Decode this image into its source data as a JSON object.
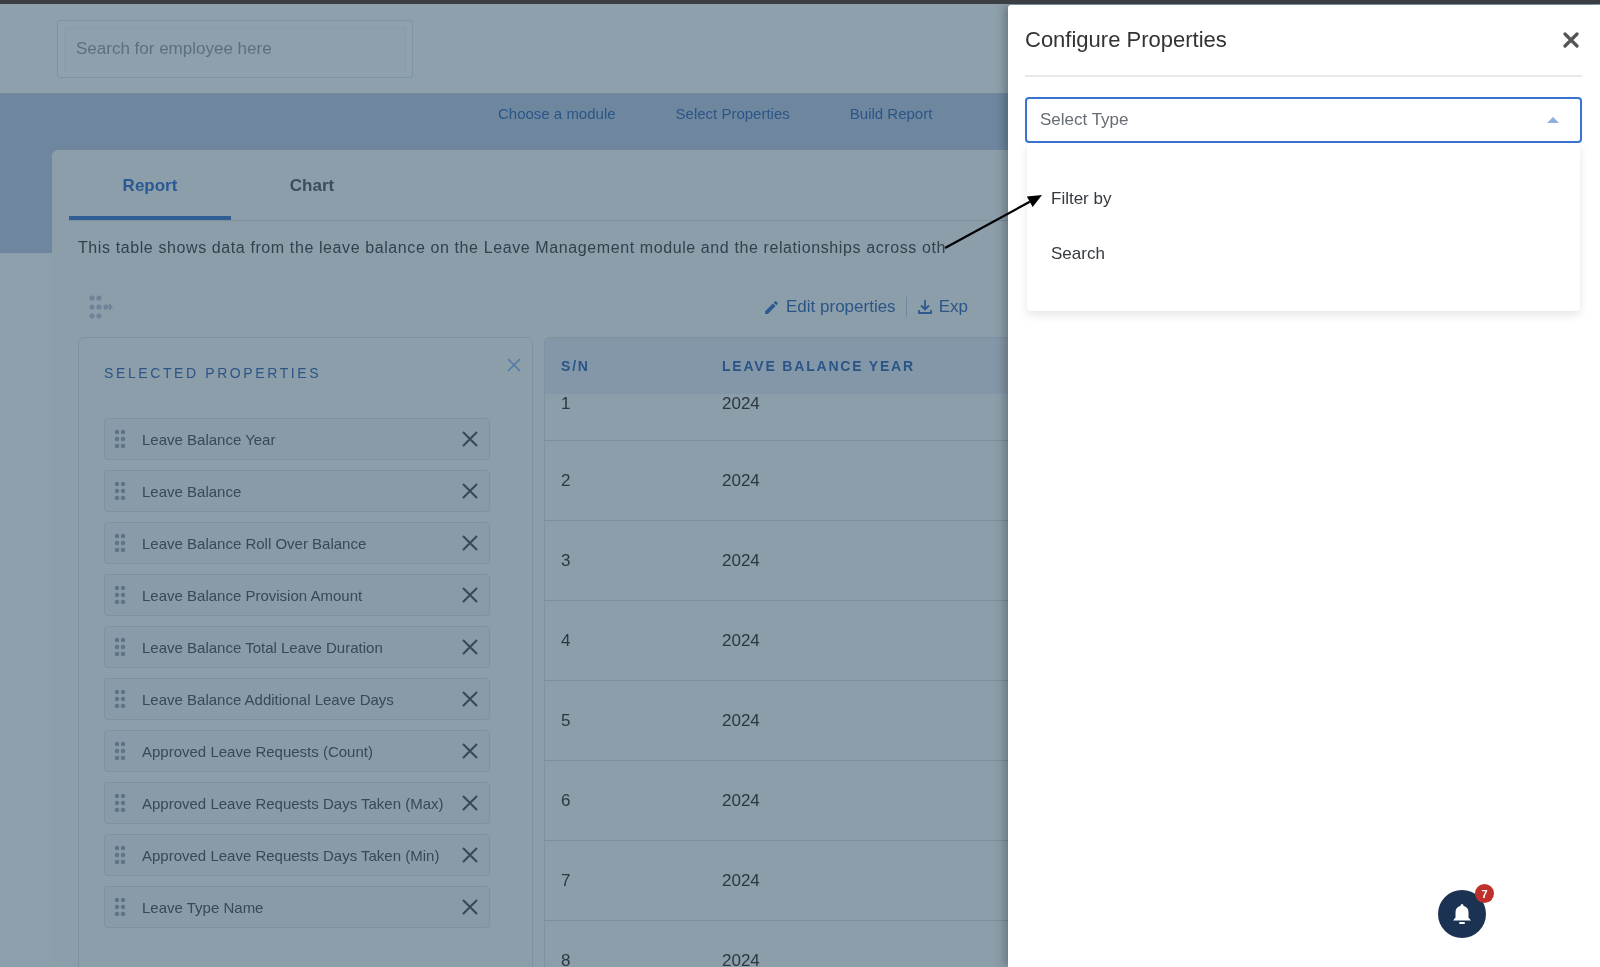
{
  "search": {
    "placeholder": "Search for employee here"
  },
  "steps": [
    "Choose a module",
    "Select Properties",
    "Build Report"
  ],
  "tabs": [
    {
      "label": "Report",
      "selected": true
    },
    {
      "label": "Chart",
      "selected": false
    }
  ],
  "description": "This table shows data from the leave balance on the Leave Management module and the relationships across oth",
  "toolbar": {
    "edit": "Edit properties",
    "export": "Exp"
  },
  "selected_properties": {
    "title": "SELECTED PROPERTIES",
    "items": [
      "Leave Balance Year",
      "Leave Balance",
      "Leave Balance Roll Over Balance",
      "Leave Balance Provision Amount",
      "Leave Balance Total Leave Duration",
      "Leave Balance Additional Leave Days",
      "Approved Leave Requests (Count)",
      "Approved Leave Requests Days Taken (Max)",
      "Approved Leave Requests Days Taken (Min)",
      "Leave Type Name"
    ]
  },
  "table": {
    "columns": [
      "S/N",
      "LEAVE BALANCE YEAR"
    ],
    "rows": [
      [
        "1",
        "2024"
      ],
      [
        "2",
        "2024"
      ],
      [
        "3",
        "2024"
      ],
      [
        "4",
        "2024"
      ],
      [
        "5",
        "2024"
      ],
      [
        "6",
        "2024"
      ],
      [
        "7",
        "2024"
      ],
      [
        "8",
        "2024"
      ]
    ]
  },
  "drawer": {
    "title": "Configure Properties",
    "select": {
      "placeholder": "Select Type",
      "expanded": true,
      "options": [
        {
          "label": "Filter by",
          "selected": false
        },
        {
          "label": "Search",
          "selected": false
        }
      ]
    }
  },
  "notifications": {
    "count": "7"
  }
}
